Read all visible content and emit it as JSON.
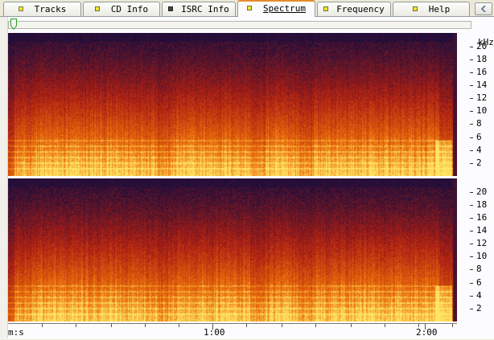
{
  "tabs": [
    {
      "label": "Tracks",
      "icon": "note-icon",
      "active": false
    },
    {
      "label": "CD Info",
      "icon": "flag-icon",
      "active": false
    },
    {
      "label": "ISRC Info",
      "icon": "disk-icon",
      "active": false
    },
    {
      "label": "Spectrum",
      "icon": "flag-icon",
      "active": true
    },
    {
      "label": "Frequency",
      "icon": "flag-icon",
      "active": false
    },
    {
      "label": "Help",
      "icon": "flag-icon",
      "active": false
    }
  ],
  "freq_axis": {
    "unit": "kHz",
    "ticks": [
      "20",
      "18",
      "16",
      "14",
      "12",
      "10",
      "8",
      "6",
      "4",
      "2"
    ]
  },
  "time_axis": {
    "unit": "m:s",
    "labels": [
      "1:00",
      "2:00"
    ]
  },
  "colors": {
    "spectrum_low": "#1a0d3c",
    "spectrum_mid": "#c84a0a",
    "spectrum_high": "#ffe060",
    "accent_tab": "#e68b2c"
  }
}
